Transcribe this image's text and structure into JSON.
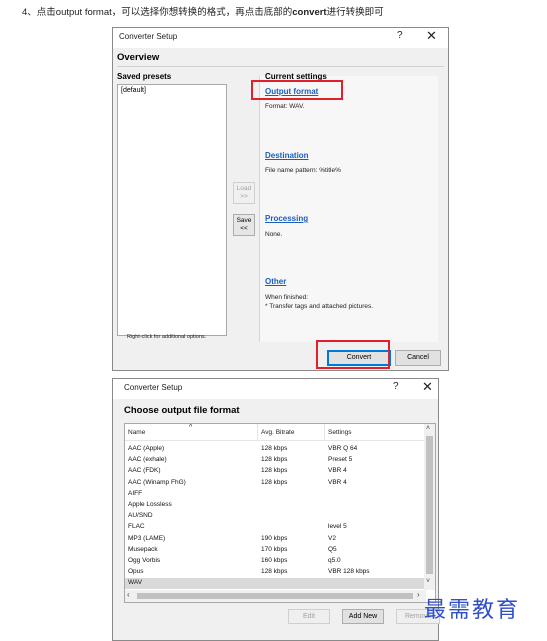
{
  "caption": {
    "prefix": "4、点击output format，可以选择你想转换的格式，再点击底部的",
    "bold": "convert",
    "suffix": "进行转换即可"
  },
  "dialog1": {
    "title": "Converter Setup",
    "help_glyph": "?",
    "close_glyph": "✕",
    "heading": "Overview",
    "saved_presets_label": "Saved presets",
    "presets": [
      "[default]"
    ],
    "load_button": "Load >>",
    "save_button": "Save <<",
    "hint": "Right-click for additional options.",
    "current_settings_label": "Current settings",
    "output_format_link": "Output format",
    "output_format_value": "Format: WAV.",
    "destination_link": "Destination",
    "destination_value": "File name pattern: %title%",
    "processing_link": "Processing",
    "processing_value": "None.",
    "other_link": "Other",
    "other_value_line1": "When finished:",
    "other_value_line2": "* Transfer tags and attached pictures.",
    "convert_button": "Convert",
    "cancel_button": "Cancel",
    "highlight_color": "#e0202a"
  },
  "dialog2": {
    "title": "Converter Setup",
    "help_glyph": "?",
    "close_glyph": "✕",
    "heading": "Choose output file format",
    "columns": [
      "Name",
      "Avg. Bitrate",
      "Settings"
    ],
    "rows": [
      {
        "name": "AAC (Apple)",
        "bitrate": "128 kbps",
        "settings": "VBR Q 64"
      },
      {
        "name": "AAC (exhale)",
        "bitrate": "128 kbps",
        "settings": "Preset 5"
      },
      {
        "name": "AAC (FDK)",
        "bitrate": "128 kbps",
        "settings": "VBR 4"
      },
      {
        "name": "AAC (Winamp FhG)",
        "bitrate": "128 kbps",
        "settings": "VBR 4"
      },
      {
        "name": "AIFF",
        "bitrate": "",
        "settings": ""
      },
      {
        "name": "Apple Lossless",
        "bitrate": "",
        "settings": ""
      },
      {
        "name": "AU/SND",
        "bitrate": "",
        "settings": ""
      },
      {
        "name": "FLAC",
        "bitrate": "",
        "settings": "level 5"
      },
      {
        "name": "MP3 (LAME)",
        "bitrate": "190 kbps",
        "settings": "V2"
      },
      {
        "name": "Musepack",
        "bitrate": "170 kbps",
        "settings": "Q5"
      },
      {
        "name": "Ogg Vorbis",
        "bitrate": "160 kbps",
        "settings": "q5.0"
      },
      {
        "name": "Opus",
        "bitrate": "128 kbps",
        "settings": "VBR 128 kbps"
      },
      {
        "name": "WAV",
        "bitrate": "",
        "settings": ""
      }
    ],
    "selected_row": "WAV",
    "edit_button": "Edit",
    "add_new_button": "Add New",
    "remove_button": "Remove"
  },
  "watermark": "最需教育"
}
